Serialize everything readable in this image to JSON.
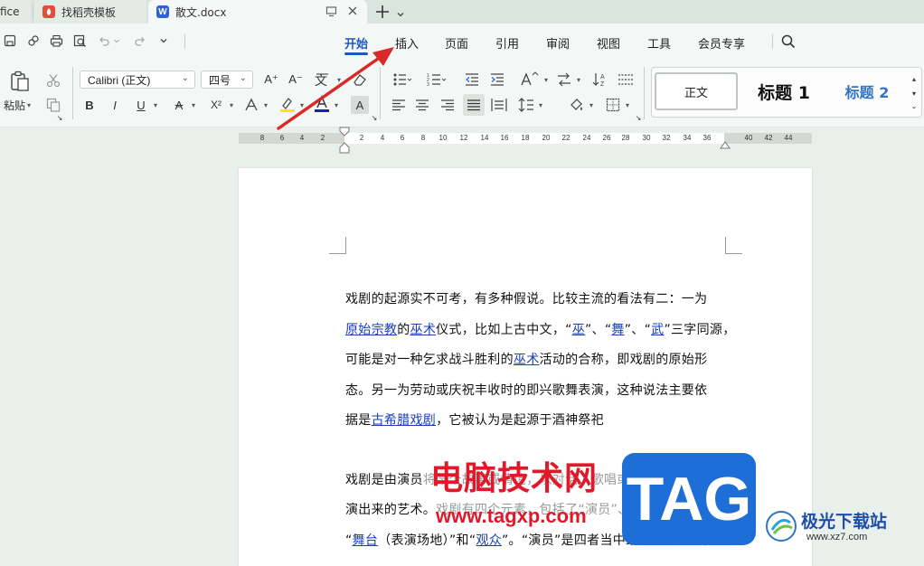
{
  "tabs": [
    {
      "label": "fice"
    },
    {
      "label": "找稻壳模板",
      "icon": "docer-icon"
    },
    {
      "label": "散文.docx",
      "icon": "wps-writer-icon"
    }
  ],
  "menu": [
    "开始",
    "插入",
    "页面",
    "引用",
    "审阅",
    "视图",
    "工具",
    "会员专享"
  ],
  "menu_selected": "开始",
  "ribbon": {
    "paste_label": "粘贴",
    "font_name": "Calibri (正文)",
    "font_size": "四号",
    "bold": "B",
    "italic": "I",
    "underline": "U",
    "superscript": "X²",
    "styles": [
      "正文",
      "标题 1",
      "标题 2"
    ],
    "glyph_font_grow": "A⁺",
    "glyph_font_shrink": "A⁻",
    "glyph_char_a": "A"
  },
  "ruler_ticks": [
    "8",
    "6",
    "4",
    "2",
    "2",
    "4",
    "6",
    "8",
    "10",
    "12",
    "14",
    "16",
    "18",
    "20",
    "22",
    "24",
    "26",
    "28",
    "30",
    "32",
    "34",
    "36",
    "40",
    "42",
    "44"
  ],
  "document": {
    "para1": [
      {
        "segs": [
          {
            "t": "戏剧的起源实不可考，有多种假说。比较主流的看法有二：一为"
          }
        ]
      },
      {
        "segs": [
          {
            "t": "原始宗教",
            "link": true
          },
          {
            "t": "的"
          },
          {
            "t": "巫术",
            "link": true
          },
          {
            "t": "仪式，比如上古中文，“"
          },
          {
            "t": "巫",
            "link": true
          },
          {
            "t": "”、“"
          },
          {
            "t": "舞",
            "link": true
          },
          {
            "t": "”、“"
          },
          {
            "t": "武",
            "link": true
          },
          {
            "t": "”三字同源，"
          }
        ]
      },
      {
        "segs": [
          {
            "t": "可能是对一种乞求战斗胜利的"
          },
          {
            "t": "巫术",
            "link": true
          },
          {
            "t": "活动的合称，即戏剧的原始形"
          }
        ]
      },
      {
        "segs": [
          {
            "t": "态。另一为劳动或庆祝丰收时的即兴歌舞表演，这种说法主要依"
          }
        ]
      },
      {
        "segs": [
          {
            "t": "据是"
          },
          {
            "t": "古希腊戏剧",
            "link": true
          },
          {
            "t": "，它被认为是起源于酒神祭祀"
          }
        ]
      }
    ],
    "para2": [
      {
        "segs": [
          {
            "t": "戏剧是由演员"
          },
          {
            "t": "将某个故事或情境，以对话、歌唱或动作等方式表",
            "faded": true
          }
        ]
      },
      {
        "segs": [
          {
            "t": "演出来的艺术。"
          },
          {
            "t": "戏剧有四个元素，包括了“演员”、“故事（情境）”、",
            "faded": true
          }
        ]
      },
      {
        "segs": [
          {
            "t": "“"
          },
          {
            "t": "舞台",
            "link": true
          },
          {
            "t": "（表演场地）”和“"
          },
          {
            "t": "观众",
            "link": true
          },
          {
            "t": "”。“演员”是四者当中最重要的元素，"
          }
        ]
      }
    ]
  },
  "watermark": {
    "text": "电脑技术网",
    "url": "www.tagxp.com",
    "badge": "TAG",
    "logo_text": "极光下载站",
    "logo_url": "www.xz7.com"
  },
  "colors": {
    "accent": "#1f57c3",
    "link": "#1a3fb8",
    "watermark_red": "#e0182a",
    "badge_blue": "#1e6ed8",
    "arrow_red": "#d92a2a"
  }
}
